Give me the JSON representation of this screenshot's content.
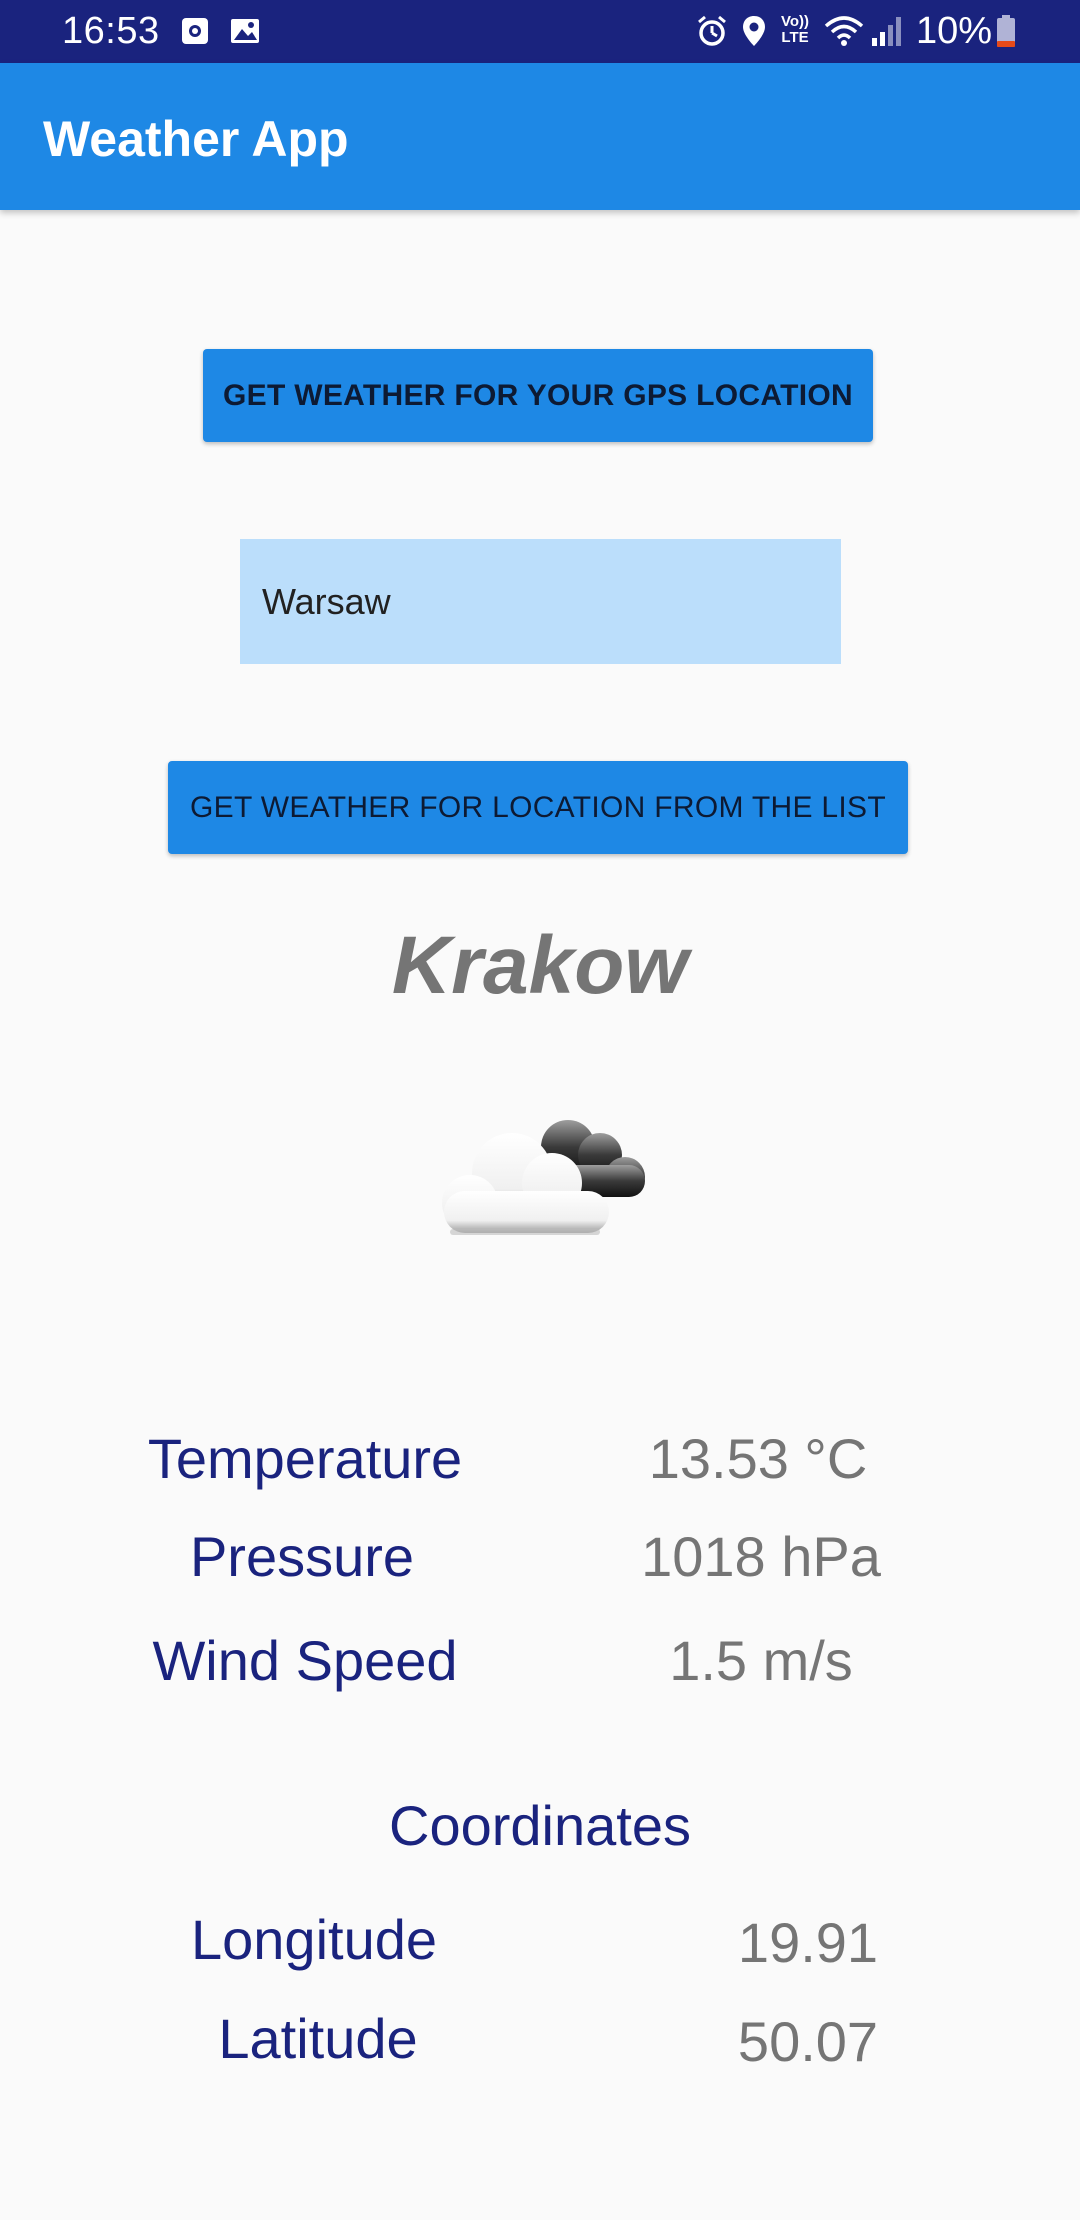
{
  "status_bar": {
    "time": "16:53",
    "battery": "10%",
    "left_icons": [
      "screen-record-icon",
      "gallery-icon"
    ],
    "right_icons": [
      "alarm-icon",
      "location-icon",
      "volte-icon",
      "wifi-icon",
      "signal-icon",
      "battery-icon"
    ],
    "volte_label": "Vo)) LTE"
  },
  "app_bar": {
    "title": "Weather App",
    "color": "#1e88e5"
  },
  "buttons": {
    "gps": "GET WEATHER FOR YOUR GPS LOCATION",
    "from_list": "GET WEATHER FOR LOCATION FROM THE LIST"
  },
  "city_selector": {
    "selected": "Warsaw",
    "color": "#bbdefb"
  },
  "weather": {
    "city": "Krakow",
    "icon": "partly-cloudy-icon",
    "rows": [
      {
        "label": "Temperature",
        "value": "13.53 °C"
      },
      {
        "label": "Pressure",
        "value": "1018 hPa"
      },
      {
        "label": "Wind Speed",
        "value": "1.5 m/s"
      }
    ]
  },
  "coordinates": {
    "title": "Coordinates",
    "rows": [
      {
        "label": "Longitude",
        "value": "19.91"
      },
      {
        "label": "Latitude",
        "value": "50.07"
      }
    ]
  },
  "colors": {
    "status_bar": "#1a237e",
    "label_text": "#1a237e",
    "value_text": "#757575",
    "background": "#fafafa"
  }
}
